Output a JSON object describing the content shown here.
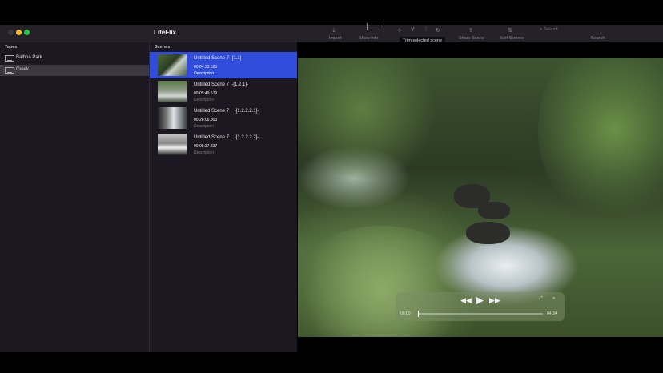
{
  "app": {
    "title": "LifeFlix"
  },
  "toolbar": {
    "import_label": "Import",
    "show_info_label": "Show Info",
    "trim_tooltip": "Trim selected scene",
    "share_label": "Share Scene",
    "sort_label": "Sort Scenes",
    "search_placeholder": "Search",
    "search_label": "Search"
  },
  "sidebar": {
    "header": "Tapes",
    "items": [
      {
        "label": "Balboa Park",
        "selected": false
      },
      {
        "label": "Creek",
        "selected": true
      }
    ]
  },
  "scenes": {
    "header": "Scenes",
    "items": [
      {
        "title": "Untitled Scene 7 -[1.1]-",
        "time": "00:04:33.525",
        "description": "Description",
        "selected": true
      },
      {
        "title": "Untitled Scene 7  -[1.2.1]-",
        "time": "00:05:49.579",
        "description": "Description",
        "selected": false
      },
      {
        "title": "Untitled Scene 7    -[1.2.2.2.1]-",
        "time": "00:28:06.803",
        "description": "Description",
        "selected": false
      },
      {
        "title": "Untitled Scene 7    -[1.2.2.2.2]-",
        "time": "00:05:37.337",
        "description": "Description",
        "selected": false
      }
    ]
  },
  "player": {
    "current_time": "00:00",
    "duration": "04:34",
    "progress": 0.0
  },
  "icons": {
    "rewind": "rewind-icon",
    "play": "play-icon",
    "fast_forward": "fast-forward-icon",
    "fullscreen": "fullscreen-icon",
    "skip": "skip-icon"
  },
  "colors": {
    "selection": "#2f4cdc",
    "sidebar_selection": "#3b3840",
    "background": "#1b1821"
  }
}
